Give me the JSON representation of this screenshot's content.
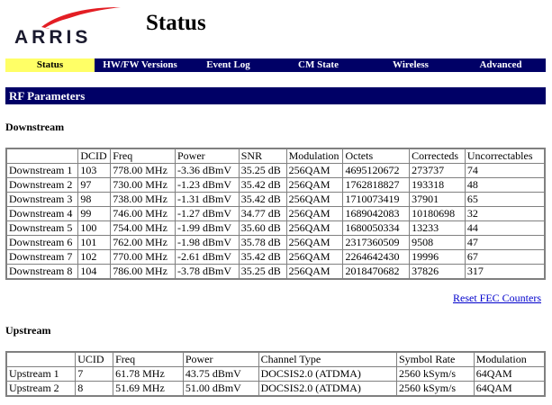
{
  "header": {
    "logo_text": "ARRIS",
    "title": "Status"
  },
  "nav": {
    "tabs": [
      "Status",
      "HW/FW Versions",
      "Event Log",
      "CM State",
      "Wireless",
      "Advanced"
    ]
  },
  "section": {
    "title": "RF Parameters"
  },
  "downstream": {
    "heading": "Downstream",
    "columns": [
      "",
      "DCID",
      "Freq",
      "Power",
      "SNR",
      "Modulation",
      "Octets",
      "Correcteds",
      "Uncorrectables"
    ],
    "rows": [
      [
        "Downstream 1",
        "103",
        "778.00 MHz",
        "-3.36 dBmV",
        "35.25 dB",
        "256QAM",
        "4695120672",
        "273737",
        "74"
      ],
      [
        "Downstream 2",
        "97",
        "730.00 MHz",
        "-1.23 dBmV",
        "35.42 dB",
        "256QAM",
        "1762818827",
        "193318",
        "48"
      ],
      [
        "Downstream 3",
        "98",
        "738.00 MHz",
        "-1.31 dBmV",
        "35.42 dB",
        "256QAM",
        "1710073419",
        "37901",
        "65"
      ],
      [
        "Downstream 4",
        "99",
        "746.00 MHz",
        "-1.27 dBmV",
        "34.77 dB",
        "256QAM",
        "1689042083",
        "10180698",
        "32"
      ],
      [
        "Downstream 5",
        "100",
        "754.00 MHz",
        "-1.99 dBmV",
        "35.60 dB",
        "256QAM",
        "1680050334",
        "13233",
        "44"
      ],
      [
        "Downstream 6",
        "101",
        "762.00 MHz",
        "-1.98 dBmV",
        "35.78 dB",
        "256QAM",
        "2317360509",
        "9508",
        "47"
      ],
      [
        "Downstream 7",
        "102",
        "770.00 MHz",
        "-2.61 dBmV",
        "35.42 dB",
        "256QAM",
        "2264642430",
        "19996",
        "67"
      ],
      [
        "Downstream 8",
        "104",
        "786.00 MHz",
        "-3.78 dBmV",
        "35.25 dB",
        "256QAM",
        "2018470682",
        "37826",
        "317"
      ]
    ],
    "reset_link": "Reset FEC Counters"
  },
  "upstream": {
    "heading": "Upstream",
    "columns": [
      "",
      "UCID",
      "Freq",
      "Power",
      "Channel Type",
      "Symbol Rate",
      "Modulation"
    ],
    "rows": [
      [
        "Upstream 1",
        "7",
        "61.78 MHz",
        "43.75 dBmV",
        "DOCSIS2.0 (ATDMA)",
        "2560 kSym/s",
        "64QAM"
      ],
      [
        "Upstream 2",
        "8",
        "51.69 MHz",
        "51.00 dBmV",
        "DOCSIS2.0 (ATDMA)",
        "2560 kSym/s",
        "64QAM"
      ]
    ]
  },
  "colors": {
    "nav_bg": "#000066",
    "active_tab": "#ffff66",
    "link": "#0000cc"
  }
}
